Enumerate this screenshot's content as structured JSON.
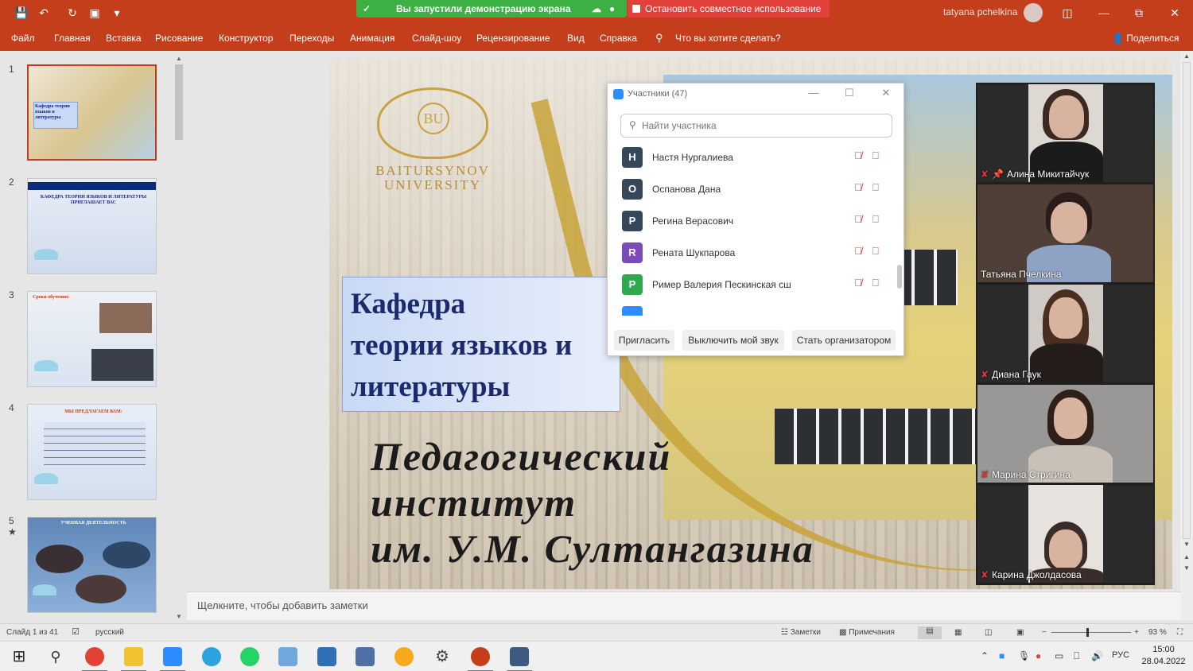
{
  "titlebar": {
    "quick_access": [
      "save-icon",
      "undo-icon",
      "redo-icon",
      "present-icon",
      "customize-icon"
    ],
    "share_banner": "Вы запустили демонстрацию экрана",
    "stop_sharing": "Остановить совместное использование",
    "user_name": "tatyana pchelkina",
    "window_controls": [
      "ribbon-display-icon",
      "minimize-icon",
      "restore-icon",
      "close-icon"
    ]
  },
  "ribbon": {
    "tabs": [
      "Файл",
      "Главная",
      "Вставка",
      "Рисование",
      "Конструктор",
      "Переходы",
      "Анимация",
      "Слайд-шоу",
      "Рецензирование",
      "Вид",
      "Справка"
    ],
    "tell_me": "Что вы хотите сделать?",
    "share": "Поделиться"
  },
  "thumbnails": [
    {
      "num": "1",
      "text": "Кафедра теории языков и литературы"
    },
    {
      "num": "2",
      "text": "КАФЕДРА ТЕОРИИ ЯЗЫКОВ И ЛИТЕРАТУРЫ ПРИГЛАШАЕТ ВАС"
    },
    {
      "num": "3",
      "text": "Сроки обучения:"
    },
    {
      "num": "4",
      "text": "МЫ ПРЕДЛАГАЕМ ВАМ:"
    },
    {
      "num": "5",
      "star": "★",
      "text": "УЧЕБНАЯ ДЕЯТЕЛЬНОСТЬ"
    }
  ],
  "slide": {
    "logo_line1": "BAITURSYNOV",
    "logo_line2": "UNIVERSITY",
    "title_lines": [
      "Кафедра",
      "теории языков и",
      "литературы"
    ],
    "subtitle_lines": [
      "Педагогический",
      "институт",
      "им. У.М. Султангазина"
    ]
  },
  "participants_panel": {
    "title": "Участники (47)",
    "search_placeholder": "Найти участника",
    "participants": [
      {
        "initial": "Н",
        "name": "Настя Нургалиева",
        "color": "#37475a",
        "camera": "off"
      },
      {
        "initial": "О",
        "name": "Оспанова Дана",
        "color": "#37475a",
        "camera": "on"
      },
      {
        "initial": "Р",
        "name": "Регина Верасович",
        "color": "#37475a",
        "camera": "on"
      },
      {
        "initial": "R",
        "name": "Рената Шукпарова",
        "color": "#7b4bb8",
        "camera": "off"
      },
      {
        "initial": "Р",
        "name": "Ример Валерия Пескинская сш",
        "color": "#2fa84f",
        "camera": "off"
      }
    ],
    "buttons": {
      "invite": "Пригласить",
      "mute_me": "Выключить мой звук",
      "make_host": "Стать организатором"
    }
  },
  "gallery": [
    {
      "name": "Алина Микитайчук",
      "bg": "#ded8d3",
      "shirt": "#1b1b1b",
      "pinned": true
    },
    {
      "name": "Татьяна Пчелкина",
      "bg": "#4f3f36",
      "shirt": "#8ea2c4",
      "pinned": false
    },
    {
      "name": "Диана Гаук",
      "bg": "#cfcac6",
      "shirt": "#241c1a",
      "pinned": false
    },
    {
      "name": "Марина Стригина",
      "bg": "#9a9896",
      "shirt": "#c9c1b7",
      "pinned": false
    },
    {
      "name": "Карина Джолдасова",
      "bg": "#e7e2de",
      "shirt": "#3a2c28",
      "pinned": false
    }
  ],
  "notes": {
    "placeholder": "Щелкните, чтобы добавить заметки"
  },
  "statusbar": {
    "slide_of": "Слайд 1 из 41",
    "language": "русский",
    "notes_btn": "Заметки",
    "comments_btn": "Примечания",
    "zoom_minus": "−",
    "zoom_plus": "+",
    "zoom": "93 %"
  },
  "taskbar": {
    "apps": [
      {
        "name": "start",
        "color": "#1b1b1b"
      },
      {
        "name": "search",
        "color": "#3a3a3a"
      },
      {
        "name": "chrome",
        "color": "#e34133",
        "running": true
      },
      {
        "name": "explorer",
        "color": "#f1c232",
        "running": true
      },
      {
        "name": "zoom",
        "color": "#2d8cff",
        "running": true
      },
      {
        "name": "telegram",
        "color": "#2aa3df"
      },
      {
        "name": "whatsapp",
        "color": "#25d366"
      },
      {
        "name": "control-panel",
        "color": "#6fa8dc"
      },
      {
        "name": "remote-desktop",
        "color": "#2f6fb5"
      },
      {
        "name": "calculator",
        "color": "#4f6fa5"
      },
      {
        "name": "edge",
        "color": "#f7a81b"
      },
      {
        "name": "settings",
        "color": "#555555"
      },
      {
        "name": "powerpoint",
        "color": "#c43e1c",
        "running": true
      },
      {
        "name": "film-clapper",
        "color": "#3d5a80",
        "running": true
      }
    ],
    "lang": "РУС",
    "time": "15:00",
    "date": "28.04.2022"
  }
}
